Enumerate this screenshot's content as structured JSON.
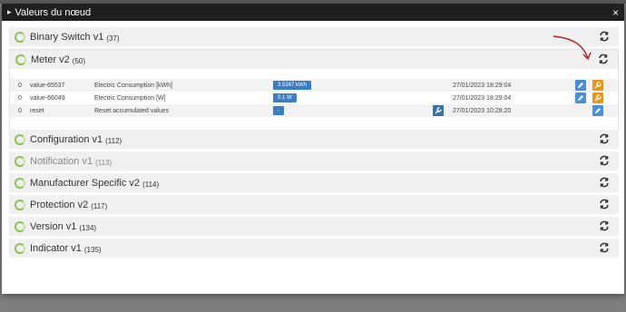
{
  "window": {
    "title": "Valeurs du nœud",
    "close_label": "×"
  },
  "sections": [
    {
      "title": "Binary Switch v1",
      "count": "(37)"
    },
    {
      "title": "Meter v2",
      "count": "(50)"
    },
    {
      "title": "Configuration v1",
      "count": "(112)"
    },
    {
      "title": "Notification v1",
      "count": "(113)"
    },
    {
      "title": "Manufacturer Specific v2",
      "count": "(114)"
    },
    {
      "title": "Protection v2",
      "count": "(117)"
    },
    {
      "title": "Version v1",
      "count": "(134)"
    },
    {
      "title": "Indicator v1",
      "count": "(135)"
    }
  ],
  "meter_rows": [
    {
      "instance": "0",
      "id": "value-65537",
      "label": "Electric Consumption [kWh]",
      "value": "3.5247 kWh",
      "date": "27/01/2023 18:29:04"
    },
    {
      "instance": "0",
      "id": "value-66049",
      "label": "Electric Consumption [W]",
      "value": "0.1 W",
      "date": "27/01/2023 18:29:04"
    },
    {
      "instance": "0",
      "id": "reset",
      "label": "Reset accumulated values",
      "value": "-",
      "date": "27/01/2023 10:28:20"
    }
  ],
  "colors": {
    "accent_green": "#8cc152",
    "badge_blue": "#3a7dc4",
    "edit_blue": "#4a90d9",
    "wrench_orange": "#e8961c",
    "annotation_red": "#b22222"
  },
  "icons": {
    "refresh": "refresh-icon",
    "edit": "pencil-icon",
    "config": "wrench-icon",
    "section_status": "ring-icon"
  }
}
